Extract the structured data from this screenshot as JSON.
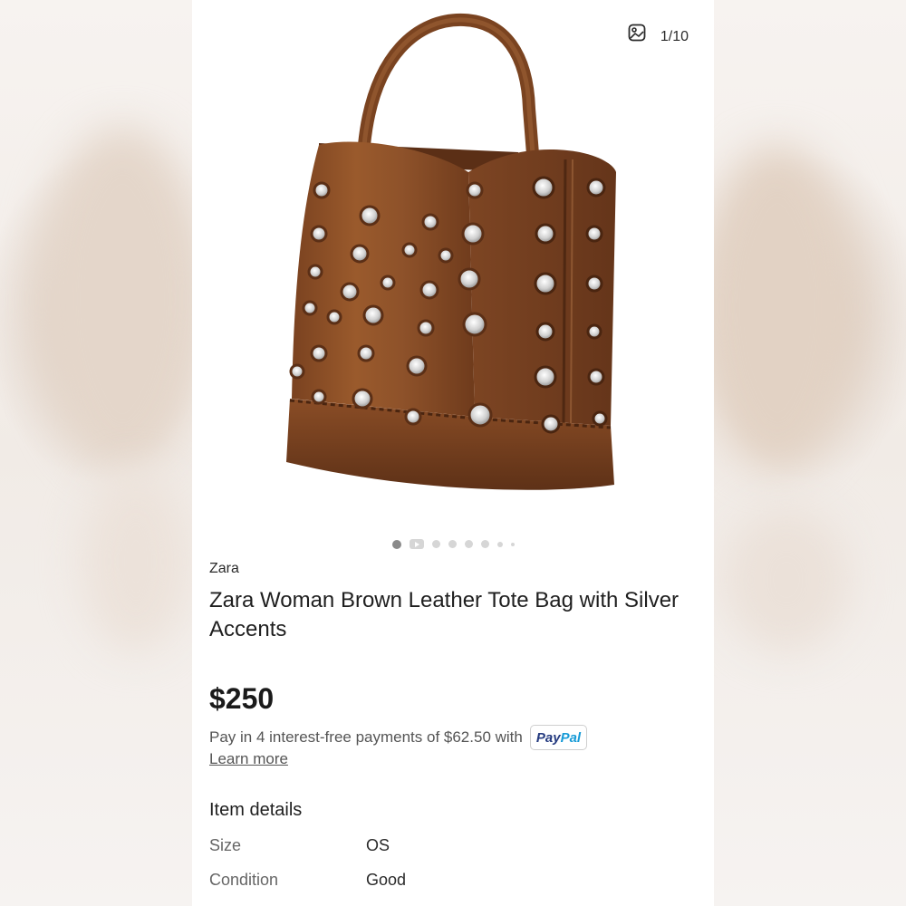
{
  "gallery": {
    "counter": "1/10",
    "counter_icon": "image-icon",
    "dots_total": 8,
    "active_index": 0
  },
  "product": {
    "brand": "Zara",
    "title": "Zara Woman Brown Leather Tote Bag with Silver Accents",
    "price": "$250",
    "installments_text": "Pay in 4 interest-free payments of $62.50 with",
    "paypal_part1": "Pay",
    "paypal_part2": "Pal",
    "learn_more": "Learn more"
  },
  "item_details": {
    "heading": "Item details",
    "rows": [
      {
        "label": "Size",
        "value": "OS"
      },
      {
        "label": "Condition",
        "value": "Good"
      }
    ]
  },
  "colors": {
    "leather": "#8a4f27",
    "leather_dark": "#6e3a1a",
    "paypal_dark": "#253b80",
    "paypal_light": "#179bd7"
  }
}
